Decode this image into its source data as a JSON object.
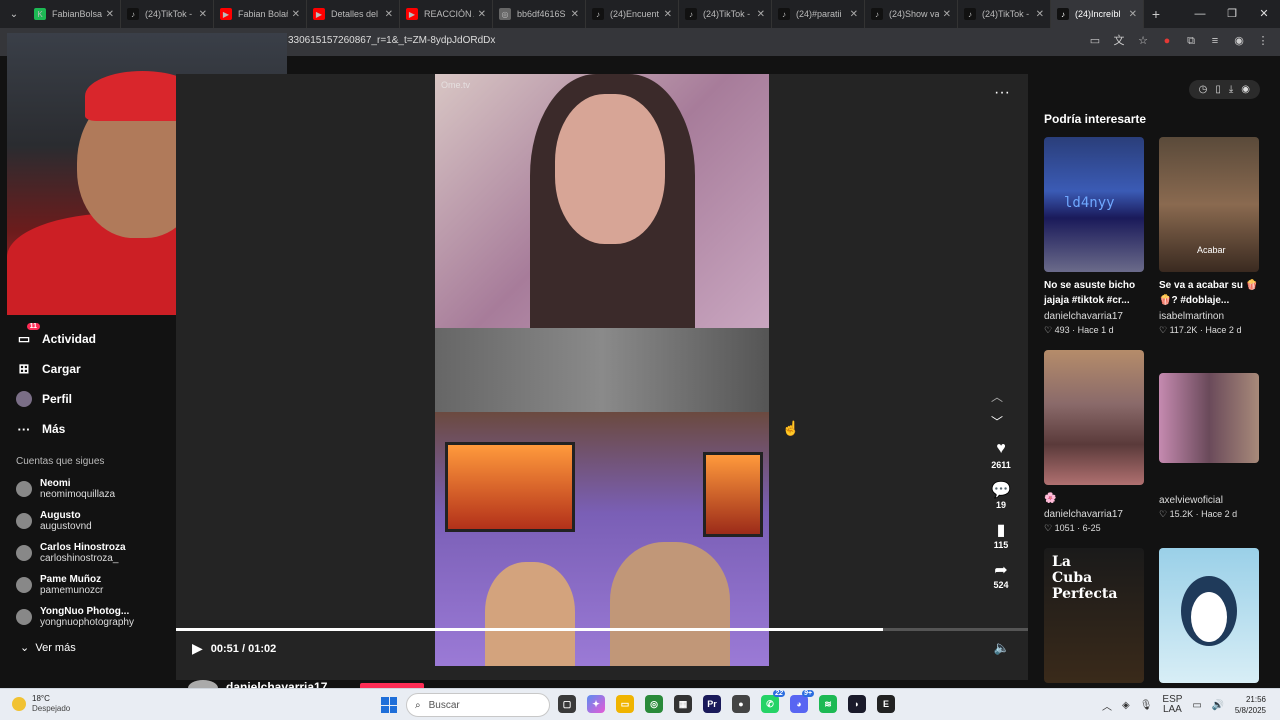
{
  "browser": {
    "tabs": [
      {
        "label": "FabianBolsa",
        "color": "#1db954",
        "icon": "K"
      },
      {
        "label": "(24)TikTok -",
        "color": "#111111",
        "icon": "♪"
      },
      {
        "label": "Fabian Bolañ",
        "color": "#ff0000",
        "icon": "▶"
      },
      {
        "label": "Detalles del",
        "color": "#ff0000",
        "icon": "▶"
      },
      {
        "label": "REACCIÓN A",
        "color": "#ff0000",
        "icon": "▶"
      },
      {
        "label": "bb6df4616S",
        "color": "#666666",
        "icon": "◎"
      },
      {
        "label": "(24)Encuent",
        "color": "#111111",
        "icon": "♪"
      },
      {
        "label": "(24)TikTok -",
        "color": "#111111",
        "icon": "♪"
      },
      {
        "label": "(24)#paratii",
        "color": "#111111",
        "icon": "♪"
      },
      {
        "label": "(24)Show va",
        "color": "#111111",
        "icon": "♪"
      },
      {
        "label": "(24)TikTok -",
        "color": "#111111",
        "icon": "♪"
      },
      {
        "label": "(24)Increíbl",
        "color": "#111111",
        "icon": "♪",
        "active": true
      }
    ],
    "url": "330615157260867_r=1&_t=ZM-8ydpJdORdDx"
  },
  "sidebar": {
    "items": [
      {
        "label": "Actividad",
        "icon": "inbox-icon",
        "glyph": "▭",
        "badge": "11"
      },
      {
        "label": "Cargar",
        "icon": "upload-icon",
        "glyph": "⊞"
      },
      {
        "label": "Perfil",
        "icon": "profile-icon",
        "glyph": "●"
      },
      {
        "label": "Más",
        "icon": "more-icon",
        "glyph": "···"
      }
    ],
    "following_title": "Cuentas que sigues",
    "following": [
      {
        "name": "Neomi",
        "handle": "neomimoquillaza"
      },
      {
        "name": "Augusto",
        "handle": "augustovnd"
      },
      {
        "name": "Carlos Hinostroza",
        "handle": "carloshinostroza_"
      },
      {
        "name": "Pame Muñoz",
        "handle": "pamemunozcr"
      },
      {
        "name": "YongNuo Photog...",
        "handle": "yongnuophotography"
      }
    ],
    "see_more": "Ver más"
  },
  "player": {
    "watermark": "Ome.tv",
    "likes": "2611",
    "comments": "19",
    "saves": "115",
    "shares": "524",
    "time": "00:51 / 01:02",
    "progress": 0.83,
    "author": "danielchavarria17"
  },
  "right_panel": {
    "title": "Podría interesarte",
    "cards": [
      {
        "caption1": "No se asuste bicho",
        "caption2": "jajaja #tiktok #cr...",
        "author": "danielchavarria17",
        "stats": "♡ 493 · Hace 1 d"
      },
      {
        "caption1": "Se va a acabar su 🍿",
        "caption2": "🍿? #doblaje...",
        "author": "isabelmartinon",
        "stats": "♡ 117.2K · Hace 2 d"
      },
      {
        "caption1": "🌸",
        "caption2": "",
        "author": "danielchavarria17",
        "stats": "♡ 1051 · 6-25"
      },
      {
        "caption1": "",
        "caption2": "",
        "author": "axelviewoficial",
        "stats": "♡ 15.2K · Hace 2 d"
      },
      {
        "caption1": "",
        "caption2": "",
        "author": "",
        "stats": "",
        "overlay": "La Cuba Perfecta"
      },
      {
        "caption1": "",
        "caption2": "",
        "author": "",
        "stats": ""
      }
    ],
    "thumb_texts": [
      "ld4nyy",
      "Acabar"
    ]
  },
  "taskbar": {
    "temp": "18°C",
    "weather": "Despejado",
    "search": "Buscar",
    "lang1": "ESP",
    "lang2": "LAA",
    "time": "21:56",
    "date": "5/8/2025",
    "badge1": "22",
    "badge2": "9+"
  }
}
